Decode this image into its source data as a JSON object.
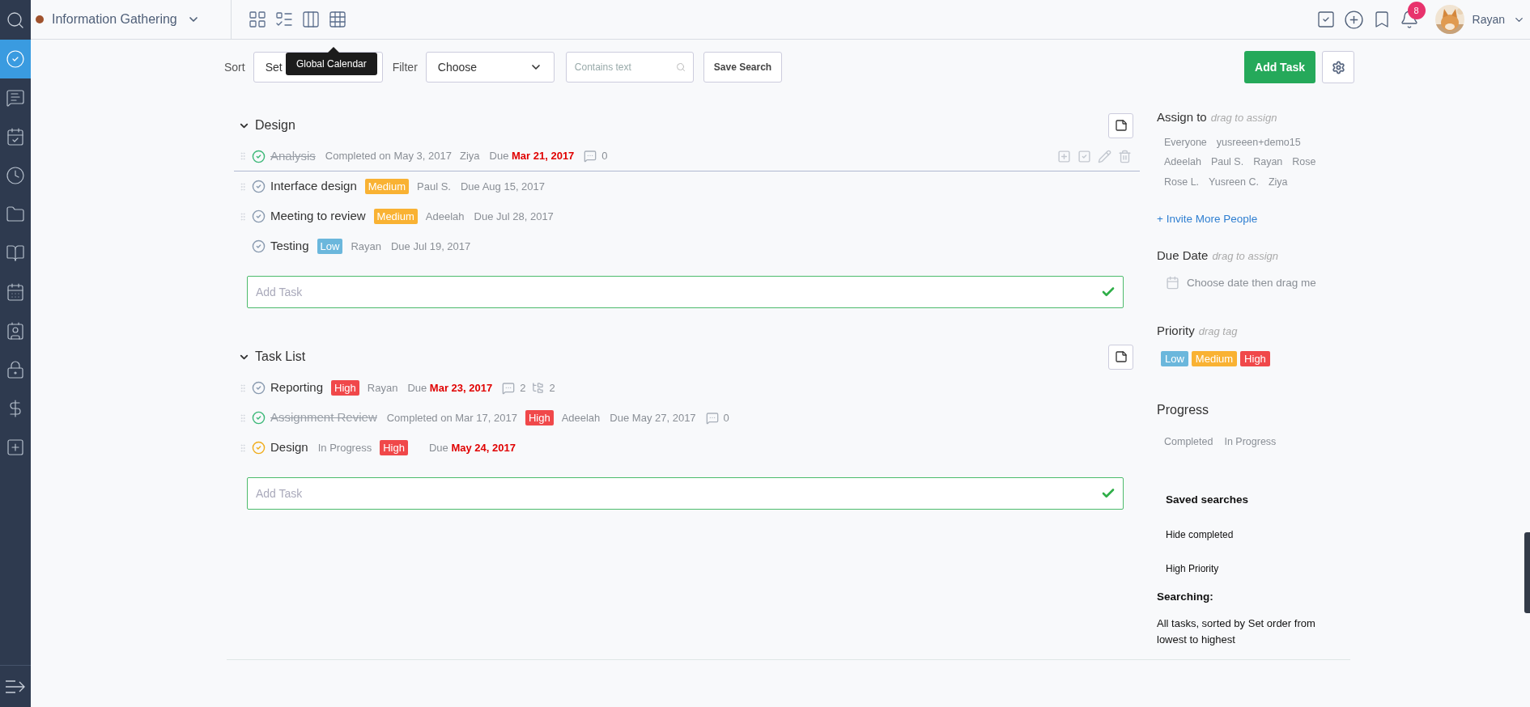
{
  "sidebar": {
    "items": [
      {
        "kind": "tasks",
        "selected": true
      },
      {
        "kind": "messages",
        "selected": false
      },
      {
        "kind": "schedule",
        "selected": false
      },
      {
        "kind": "time",
        "selected": false
      },
      {
        "kind": "files",
        "selected": false
      },
      {
        "kind": "wiki",
        "selected": false
      },
      {
        "kind": "calendar",
        "selected": false
      },
      {
        "kind": "contacts",
        "selected": false
      },
      {
        "kind": "passwords",
        "selected": false
      },
      {
        "kind": "invoices",
        "selected": false
      },
      {
        "kind": "new",
        "selected": false
      }
    ]
  },
  "header": {
    "project": {
      "name": "Information Gathering",
      "color": "#a0522d"
    },
    "tooltip": "Global Calendar",
    "notifications": "8",
    "user": "Rayan"
  },
  "toolbar": {
    "sort_label": "Sort",
    "sort_value": "Set",
    "filter_label": "Filter",
    "filter_value": "Choose",
    "search_placeholder": "Contains text",
    "save_search": "Save Search",
    "add_task": "Add Task"
  },
  "sections": [
    {
      "title": "Design",
      "add_placeholder": "Add Task",
      "tasks": [
        {
          "name": "Analysis",
          "kind": "done",
          "handle": true,
          "hovered": true,
          "status": "Completed on May 3, 2017",
          "assignee": "Ziya",
          "due_label": "Due",
          "due": "Mar 21, 2017",
          "overdue": true,
          "comments": "0"
        },
        {
          "name": "Interface design",
          "kind": "open",
          "handle": true,
          "hovered": false,
          "priority": {
            "label": "Medium",
            "color": "#f9b233"
          },
          "assignee": "Paul S.",
          "due_label": "Due",
          "due": "Aug 15, 2017",
          "overdue": false
        },
        {
          "name": "Meeting to review",
          "kind": "open",
          "handle": true,
          "hovered": false,
          "priority": {
            "label": "Medium",
            "color": "#f9b233"
          },
          "assignee": "Adeelah",
          "due_label": "Due",
          "due": "Jul 28, 2017",
          "overdue": false
        },
        {
          "name": "Testing",
          "kind": "open",
          "handle": false,
          "hovered": false,
          "priority": {
            "label": "Low",
            "color": "#6bb7dc"
          },
          "assignee": "Rayan",
          "due_label": "Due",
          "due": "Jul 19, 2017",
          "overdue": false
        }
      ]
    },
    {
      "title": "Task List",
      "add_placeholder": "Add Task",
      "tasks": [
        {
          "name": "Reporting",
          "kind": "open",
          "handle": true,
          "hovered": false,
          "priority": {
            "label": "High",
            "color": "#f0484a"
          },
          "assignee": "Rayan",
          "due_label": "Due",
          "due": "Mar 23, 2017",
          "overdue": true,
          "comments": "2",
          "subtasks": "2"
        },
        {
          "name": "Assignment Review",
          "kind": "done",
          "handle": true,
          "hovered": false,
          "status": "Completed on Mar 17, 2017",
          "priority": {
            "label": "High",
            "color": "#f0484a"
          },
          "assignee": "Adeelah",
          "due_label": "Due",
          "due": "May 27, 2017",
          "overdue": false,
          "comments": "0"
        },
        {
          "name": "Design",
          "kind": "in_progress",
          "handle": true,
          "hovered": false,
          "status": "In Progress",
          "priority": {
            "label": "High",
            "color": "#f0484a"
          },
          "due_label": "Due",
          "due": "May 24, 2017",
          "overdue": true
        }
      ]
    }
  ],
  "panel": {
    "assign": {
      "title": "Assign to",
      "hint": "drag to assign",
      "people": [
        "Everyone",
        "yusreeen+demo15",
        "Adeelah",
        "Paul S.",
        "Rayan",
        "Rose",
        "Rose L.",
        "Yusreen C.",
        "Ziya"
      ],
      "invite": "+ Invite More People"
    },
    "due_date": {
      "title": "Due Date",
      "hint": "drag to assign",
      "picker": "Choose date then drag me"
    },
    "priority": {
      "title": "Priority",
      "hint": "drag tag",
      "tags": [
        {
          "label": "Low",
          "color": "#6bb7dc"
        },
        {
          "label": "Medium",
          "color": "#f9b233"
        },
        {
          "label": "High",
          "color": "#f0484a"
        }
      ]
    },
    "progress": {
      "title": "Progress",
      "items": [
        "Completed",
        "In Progress"
      ]
    },
    "saved_searches": {
      "title": "Saved searches",
      "items": [
        "Hide completed",
        "High Priority"
      ]
    },
    "searching": {
      "title": "Searching:",
      "text": "All tasks, sorted by Set order from lowest to highest"
    }
  }
}
